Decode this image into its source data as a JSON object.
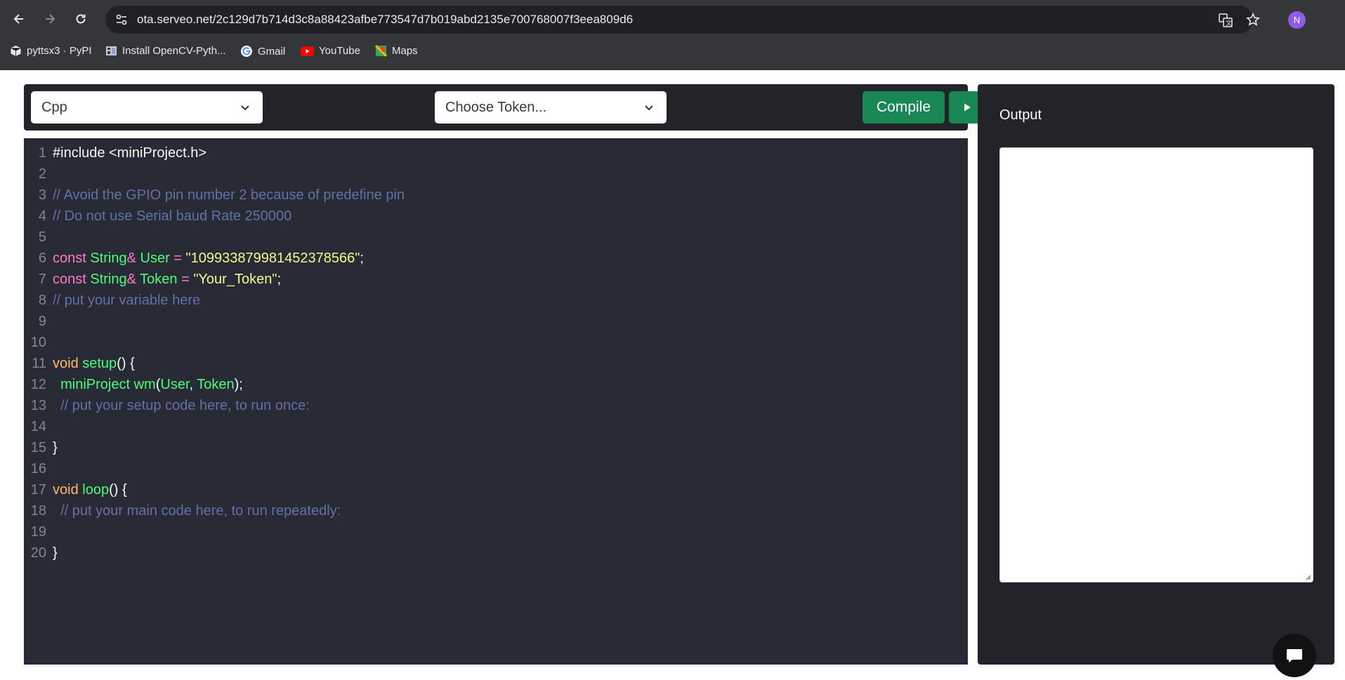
{
  "browser": {
    "url": "ota.serveo.net/2c129d7b714d3c8a88423afbe773547d7b019abd2135e700768007f3eea809d6",
    "profile_initial": "N",
    "bookmarks": [
      {
        "label": "pyttsx3 · PyPI",
        "icon": "package-icon"
      },
      {
        "label": "Install OpenCV-Pyth...",
        "icon": "page-icon"
      },
      {
        "label": "Gmail",
        "icon": "google-icon"
      },
      {
        "label": "YouTube",
        "icon": "youtube-icon"
      },
      {
        "label": "Maps",
        "icon": "maps-icon"
      }
    ]
  },
  "toolbar": {
    "language": "Cpp",
    "token": "Choose Token...",
    "compile_label": "Compile"
  },
  "editor": {
    "line_numbers": [
      "1",
      "2",
      "3",
      "4",
      "5",
      "6",
      "7",
      "8",
      "9",
      "10",
      "11",
      "12",
      "13",
      "14",
      "15",
      "16",
      "17",
      "18",
      "19",
      "20"
    ],
    "lines": [
      [
        {
          "t": "#include <miniProject.h>",
          "c": "plain"
        }
      ],
      [],
      [
        {
          "t": "// Avoid the GPIO pin number 2 because of predefine pin",
          "c": "comment"
        }
      ],
      [
        {
          "t": "// Do not use Serial baud Rate 250000",
          "c": "comment"
        }
      ],
      [],
      [
        {
          "t": "const ",
          "c": "pink"
        },
        {
          "t": "String",
          "c": "green"
        },
        {
          "t": "& ",
          "c": "pink"
        },
        {
          "t": "User",
          "c": "green"
        },
        {
          "t": " = ",
          "c": "pink"
        },
        {
          "t": "\"109933879981452378566\"",
          "c": "yellow"
        },
        {
          "t": ";",
          "c": "plain"
        }
      ],
      [
        {
          "t": "const ",
          "c": "pink"
        },
        {
          "t": "String",
          "c": "green"
        },
        {
          "t": "& ",
          "c": "pink"
        },
        {
          "t": "Token",
          "c": "green"
        },
        {
          "t": " = ",
          "c": "pink"
        },
        {
          "t": "\"Your_Token\"",
          "c": "yellow"
        },
        {
          "t": ";",
          "c": "plain"
        }
      ],
      [
        {
          "t": "// put your variable here",
          "c": "comment"
        }
      ],
      [],
      [],
      [
        {
          "t": "void ",
          "c": "orange"
        },
        {
          "t": "setup",
          "c": "green"
        },
        {
          "t": "() {",
          "c": "plain"
        }
      ],
      [
        {
          "t": "  ",
          "c": "plain"
        },
        {
          "t": "miniProject wm",
          "c": "green"
        },
        {
          "t": "(",
          "c": "plain"
        },
        {
          "t": "User",
          "c": "green"
        },
        {
          "t": ", ",
          "c": "plain"
        },
        {
          "t": "Token",
          "c": "green"
        },
        {
          "t": ");",
          "c": "plain"
        }
      ],
      [
        {
          "t": "  // put your setup code here, to run once:",
          "c": "comment"
        }
      ],
      [],
      [
        {
          "t": "}",
          "c": "plain"
        }
      ],
      [],
      [
        {
          "t": "void ",
          "c": "orange"
        },
        {
          "t": "loop",
          "c": "green"
        },
        {
          "t": "() {",
          "c": "plain"
        }
      ],
      [
        {
          "t": "  // put your main code here, to run repeatedly:",
          "c": "comment"
        }
      ],
      [],
      [
        {
          "t": "}",
          "c": "plain"
        }
      ]
    ]
  },
  "output": {
    "title": "Output",
    "value": ""
  },
  "colors": {
    "accent": "#198754",
    "editor_bg": "#282a36",
    "panel_bg": "#222429"
  }
}
